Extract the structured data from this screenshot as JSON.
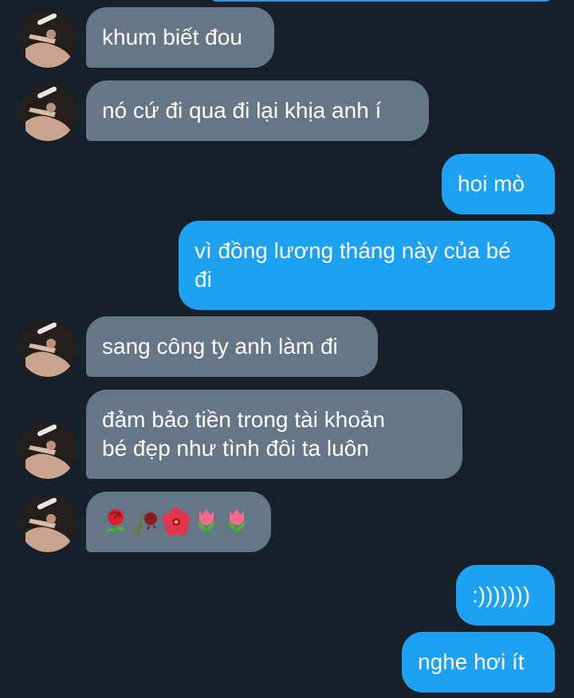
{
  "conversation": {
    "messages": [
      {
        "sender": "them",
        "text": "khum biết đou"
      },
      {
        "sender": "them",
        "text": "nó cứ đi qua đi lại khịa anh í"
      },
      {
        "sender": "me",
        "text": "hoi mò"
      },
      {
        "sender": "me",
        "text": "vì đồng lương tháng này của bé\nđi"
      },
      {
        "sender": "them",
        "text": "sang công ty anh làm đi"
      },
      {
        "sender": "them",
        "text": "đảm bảo tiền trong tài khoản\nbé đẹp như tình đôi ta luôn"
      },
      {
        "sender": "them",
        "emojis": [
          "rose",
          "wilted-flower",
          "hibiscus",
          "tulip",
          "tulip"
        ]
      },
      {
        "sender": "me",
        "text": ":)))))))"
      },
      {
        "sender": "me",
        "text": "nghe hơi ít"
      }
    ]
  },
  "colors": {
    "background": "#15202b",
    "incoming_bubble": "#657786",
    "outgoing_bubble": "#1da1f2",
    "text": "#ffffff"
  }
}
